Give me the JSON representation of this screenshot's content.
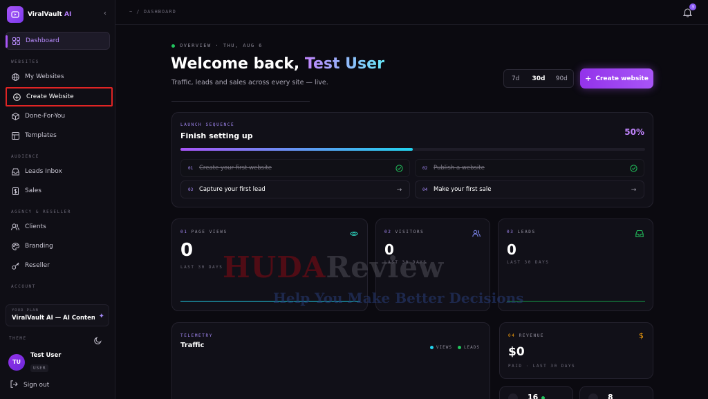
{
  "brand": {
    "name": "ViralVault",
    "ai": "AI"
  },
  "sidebar": {
    "items": [
      {
        "label": "Dashboard"
      },
      {
        "label": "My Websites"
      },
      {
        "label": "Create Website"
      },
      {
        "label": "Done-For-You"
      },
      {
        "label": "Templates"
      },
      {
        "label": "Leads Inbox"
      },
      {
        "label": "Sales"
      },
      {
        "label": "Clients"
      },
      {
        "label": "Branding"
      },
      {
        "label": "Reseller"
      }
    ],
    "sections": {
      "websites": "WEBSITES",
      "audience": "AUDIENCE",
      "agency": "AGENCY & RESELLER",
      "account": "ACCOUNT"
    },
    "plan": {
      "label": "YOUR PLAN",
      "value": "ViralVault AI — AI Content…"
    },
    "theme_label": "THEME",
    "user": {
      "initials": "TU",
      "name": "Test User",
      "role": "USER"
    },
    "signout": "Sign out"
  },
  "topbar": {
    "breadcrumb": "~ / DASHBOARD",
    "notifications": "3"
  },
  "main": {
    "overview": "OVERVIEW · THU, AUG 6",
    "welcome_prefix": "Welcome back,",
    "user_name": "Test User",
    "subtitle": "Traffic, leads and sales across every site — live.",
    "ranges": [
      "7d",
      "30d",
      "90d"
    ],
    "create_button": "Create website",
    "launch": {
      "label": "LAUNCH SEQUENCE",
      "title": "Finish setting up",
      "percent_label": "50%",
      "progress": 0.5,
      "steps": [
        {
          "num": "01",
          "label": "Create your first website",
          "done": true
        },
        {
          "num": "02",
          "label": "Publish a website",
          "done": true
        },
        {
          "num": "03",
          "label": "Capture your first lead",
          "done": false
        },
        {
          "num": "04",
          "label": "Make your first sale",
          "done": false
        }
      ]
    },
    "stats": [
      {
        "num": "01",
        "label": "PAGE VIEWS",
        "value": "0",
        "sub": "LAST 30 DAYS"
      },
      {
        "num": "02",
        "label": "VISITORS",
        "value": "0",
        "sub": "LAST 30 DAYS"
      },
      {
        "num": "03",
        "label": "LEADS",
        "value": "0",
        "sub": "LAST 30 DAYS"
      }
    ],
    "telemetry": {
      "label": "TELEMETRY",
      "title": "Traffic",
      "legend": [
        "VIEWS",
        "LEADS"
      ]
    },
    "revenue": {
      "num": "04",
      "label": "REVENUE",
      "value": "$0",
      "sub": "PAID · LAST 30 DAYS"
    },
    "mini": [
      {
        "value": "16"
      },
      {
        "value": "8"
      }
    ]
  },
  "watermark": {
    "line1a": "HUDA",
    "line1b": "Review",
    "line2": "Help You Make Better Decisions"
  },
  "colors": {
    "accent": "#a855f7",
    "cyan": "#22d3ee",
    "green": "#22c55e",
    "highlight": "#e02424"
  }
}
